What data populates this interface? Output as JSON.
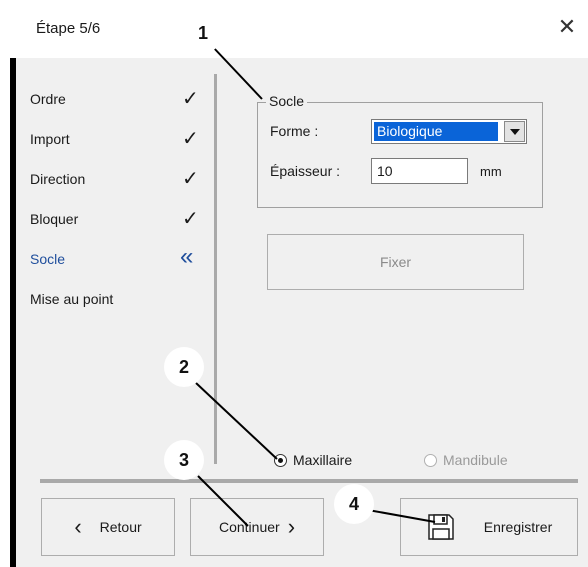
{
  "window": {
    "title": "Étape 5/6",
    "close_glyph": "✕"
  },
  "steps": [
    {
      "label": "Ordre",
      "mark": "✓",
      "current": false
    },
    {
      "label": "Import",
      "mark": "✓",
      "current": false
    },
    {
      "label": "Direction",
      "mark": "✓",
      "current": false
    },
    {
      "label": "Bloquer",
      "mark": "✓",
      "current": false
    },
    {
      "label": "Socle",
      "mark": "«",
      "current": true
    },
    {
      "label": "Mise au point",
      "mark": "",
      "current": false
    }
  ],
  "socle": {
    "group_title": "Socle",
    "forme_label": "Forme :",
    "forme_value": "Biologique",
    "epaisseur_label": "Épaisseur :",
    "epaisseur_value": "10",
    "unit": "mm"
  },
  "buttons": {
    "fixer": "Fixer",
    "retour": "Retour",
    "continuer": "Continuer",
    "enregistrer": "Enregistrer"
  },
  "radios": {
    "maxillaire": "Maxillaire",
    "mandibule": "Mandibule",
    "selected": "maxillaire"
  },
  "callouts": [
    "1",
    "2",
    "3",
    "4"
  ],
  "colors": {
    "current_step": "#1f4e9c",
    "selection": "#0a64d8"
  }
}
